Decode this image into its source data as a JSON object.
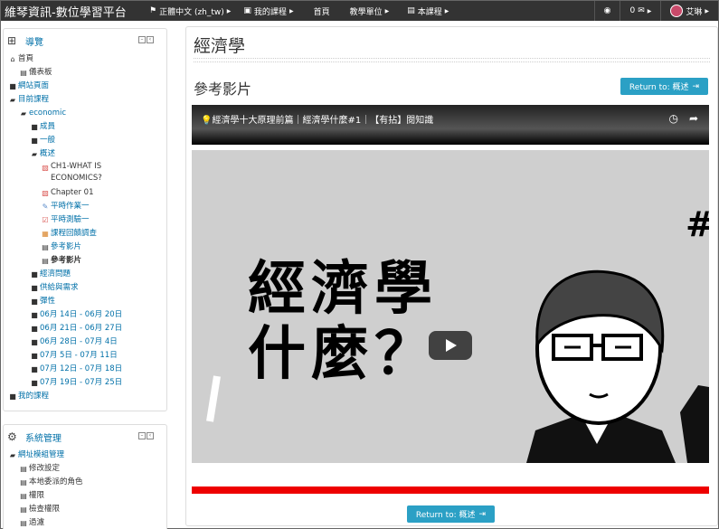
{
  "topbar": {
    "brand": "維琴資訊-數位學習平台",
    "language": "正體中文 (zh_tw)",
    "my_courses": "我的課程",
    "home": "首頁",
    "teaching_unit": "教學單位",
    "this_course": "本課程",
    "messages_count": "0",
    "user_name": "艾琳"
  },
  "navigation": {
    "title": "導覽",
    "items": [
      {
        "icon": "home-icon",
        "label": "首頁",
        "level": 0,
        "style": "dark"
      },
      {
        "icon": "page-icon",
        "label": "儀表板",
        "level": 1,
        "style": "dark"
      },
      {
        "icon": "folder-icon",
        "label": "網站頁面",
        "level": 0,
        "style": "link"
      },
      {
        "icon": "folder-open-icon",
        "label": "目前課程",
        "level": 0,
        "style": "link"
      },
      {
        "icon": "folder-open-icon",
        "label": "economic",
        "level": 1,
        "style": "link"
      },
      {
        "icon": "folder-icon",
        "label": "成員",
        "level": 2,
        "style": "link"
      },
      {
        "icon": "folder-icon",
        "label": "一般",
        "level": 2,
        "style": "link"
      },
      {
        "icon": "folder-open-icon",
        "label": "概述",
        "level": 2,
        "style": "link"
      },
      {
        "icon": "pdf-icon",
        "label": "CH1-WHAT IS ECONOMICS?",
        "level": 3,
        "style": "dark",
        "tall": true
      },
      {
        "icon": "pdf-icon",
        "label": "Chapter 01",
        "level": 3,
        "style": "dark"
      },
      {
        "icon": "assignment-icon",
        "label": "平時作業一",
        "level": 3,
        "style": "link"
      },
      {
        "icon": "quiz-icon",
        "label": "平時測驗一",
        "level": 3,
        "style": "link"
      },
      {
        "icon": "feedback-icon",
        "label": "課程回饋調查",
        "level": 3,
        "style": "link"
      },
      {
        "icon": "page-icon",
        "label": "參考影片",
        "level": 3,
        "style": "link"
      },
      {
        "icon": "page-icon",
        "label": "參考影片",
        "level": 3,
        "style": "bold"
      },
      {
        "icon": "folder-icon",
        "label": "經濟問題",
        "level": 2,
        "style": "link"
      },
      {
        "icon": "folder-icon",
        "label": "供給與需求",
        "level": 2,
        "style": "link"
      },
      {
        "icon": "folder-icon",
        "label": "彈性",
        "level": 2,
        "style": "link"
      },
      {
        "icon": "folder-icon",
        "label": "06月 14日 - 06月 20日",
        "level": 2,
        "style": "link"
      },
      {
        "icon": "folder-icon",
        "label": "06月 21日 - 06月 27日",
        "level": 2,
        "style": "link"
      },
      {
        "icon": "folder-icon",
        "label": "06月 28日 - 07月 4日",
        "level": 2,
        "style": "link"
      },
      {
        "icon": "folder-icon",
        "label": "07月 5日 - 07月 11日",
        "level": 2,
        "style": "link"
      },
      {
        "icon": "folder-icon",
        "label": "07月 12日 - 07月 18日",
        "level": 2,
        "style": "link"
      },
      {
        "icon": "folder-icon",
        "label": "07月 19日 - 07月 25日",
        "level": 2,
        "style": "link"
      },
      {
        "icon": "folder-icon",
        "label": "我的課程",
        "level": 0,
        "style": "link"
      }
    ]
  },
  "admin": {
    "title": "系統管理",
    "items": [
      {
        "icon": "folder-open-icon",
        "label": "網址模組管理",
        "level": 0,
        "style": "link"
      },
      {
        "icon": "page-icon",
        "label": "修改設定",
        "level": 1,
        "style": "dark"
      },
      {
        "icon": "page-icon",
        "label": "本地委派的角色",
        "level": 1,
        "style": "dark"
      },
      {
        "icon": "page-icon",
        "label": "權限",
        "level": 1,
        "style": "dark"
      },
      {
        "icon": "page-icon",
        "label": "檢查權限",
        "level": 1,
        "style": "dark"
      },
      {
        "icon": "page-icon",
        "label": "過濾",
        "level": 1,
        "style": "dark"
      }
    ]
  },
  "main": {
    "page_title": "經濟學",
    "section_title": "參考影片",
    "return_button": "Return to: 概述",
    "video": {
      "title": "💡經濟學十大原理前篇｜經濟學什麼#1｜【有拈】閱知識",
      "big_text_line1": "經濟學",
      "big_text_line2": "什麼？",
      "hash": "#"
    }
  }
}
